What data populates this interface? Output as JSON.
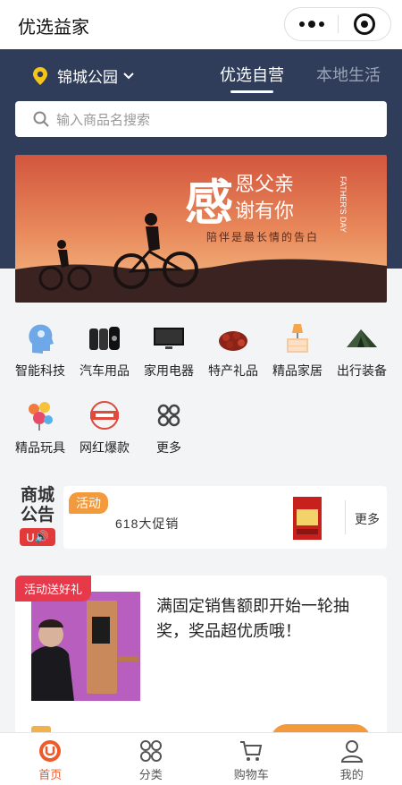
{
  "app": {
    "title": "优选益家"
  },
  "header": {
    "location": "锦城公园",
    "tabs": [
      {
        "label": "优选自营",
        "active": true
      },
      {
        "label": "本地生活",
        "active": false
      }
    ],
    "search_placeholder": "输入商品名搜索",
    "bg_color": "#2f3d5a"
  },
  "banner": {
    "main_char": "感",
    "line1": "恩父亲",
    "line2": "谢有你",
    "side_text": "FATHER'S DAY",
    "subtitle": "陪伴是最长情的告白"
  },
  "categories": [
    {
      "label": "智能科技",
      "icon": "head-tech-icon"
    },
    {
      "label": "汽车用品",
      "icon": "tire-icon"
    },
    {
      "label": "家用电器",
      "icon": "tv-icon"
    },
    {
      "label": "特产礼品",
      "icon": "specialty-icon"
    },
    {
      "label": "精品家居",
      "icon": "furniture-icon"
    },
    {
      "label": "出行装备",
      "icon": "tent-icon"
    },
    {
      "label": "精品玩具",
      "icon": "toys-icon"
    },
    {
      "label": "网红爆款",
      "icon": "hot-badge-icon"
    },
    {
      "label": "更多",
      "icon": "grid-more-icon"
    }
  ],
  "notice": {
    "title_line1": "商城",
    "title_line2": "公告",
    "badge": "U",
    "tag": "活动",
    "text": "618大促销",
    "more": "更多"
  },
  "promo": {
    "tag": "活动送好礼",
    "text": "满固定销售额即开始一轮抽奖，奖品超优质哦！"
  },
  "tabbar": [
    {
      "label": "首页",
      "active": true,
      "icon": "home-icon"
    },
    {
      "label": "分类",
      "active": false,
      "icon": "category-icon"
    },
    {
      "label": "购物车",
      "active": false,
      "icon": "cart-icon"
    },
    {
      "label": "我的",
      "active": false,
      "icon": "user-icon"
    }
  ],
  "colors": {
    "accent": "#ee5a2a",
    "tag_orange": "#f39a3c",
    "promo_red": "#e8394a"
  }
}
